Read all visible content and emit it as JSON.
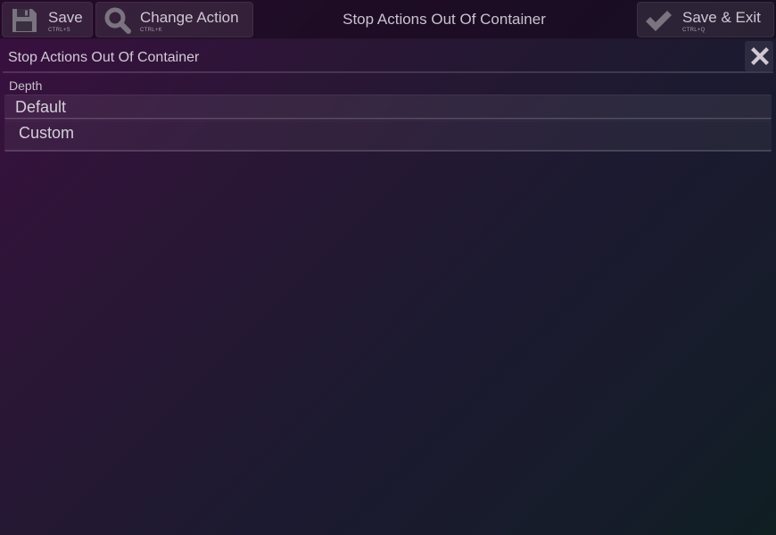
{
  "toolbar": {
    "save_label": "Save",
    "save_shortcut": "CTRL+S",
    "change_label": "Change Action",
    "change_shortcut": "CTRL+K",
    "exit_label": "Save & Exit",
    "exit_shortcut": "CTRL+Q"
  },
  "window_title": "Stop Actions Out Of Container",
  "panel": {
    "title": "Stop Actions Out Of Container",
    "field_label": "Depth",
    "options": [
      "Default",
      "Custom"
    ]
  },
  "icons": {
    "save": "floppy-disk-icon",
    "change": "magnifier-icon",
    "exit": "checkmark-icon",
    "close": "close-icon"
  },
  "colors": {
    "background_start": "#3a0f40",
    "background_end": "#0f1f22",
    "text": "#d8d2dc"
  }
}
